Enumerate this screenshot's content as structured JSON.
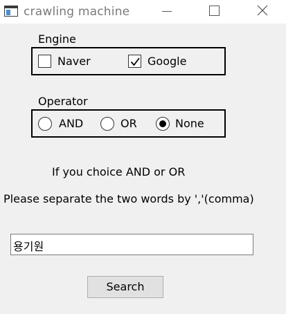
{
  "window": {
    "title": "crawling machine",
    "icons": {
      "app": "app-window-icon",
      "minimize": "minimize-icon",
      "maximize": "maximize-icon",
      "close": "close-icon"
    }
  },
  "engine": {
    "label": "Engine",
    "options": [
      {
        "label": "Naver",
        "checked": false
      },
      {
        "label": "Google",
        "checked": true
      }
    ]
  },
  "operator": {
    "label": "Operator",
    "options": [
      {
        "label": "AND",
        "selected": false
      },
      {
        "label": "OR",
        "selected": false
      },
      {
        "label": "None",
        "selected": true
      }
    ]
  },
  "instructions": {
    "line1": "If you choice AND or OR",
    "line2": "Please separate the two words by ','(comma)"
  },
  "search": {
    "value": "용기원",
    "button_label": "Search"
  }
}
